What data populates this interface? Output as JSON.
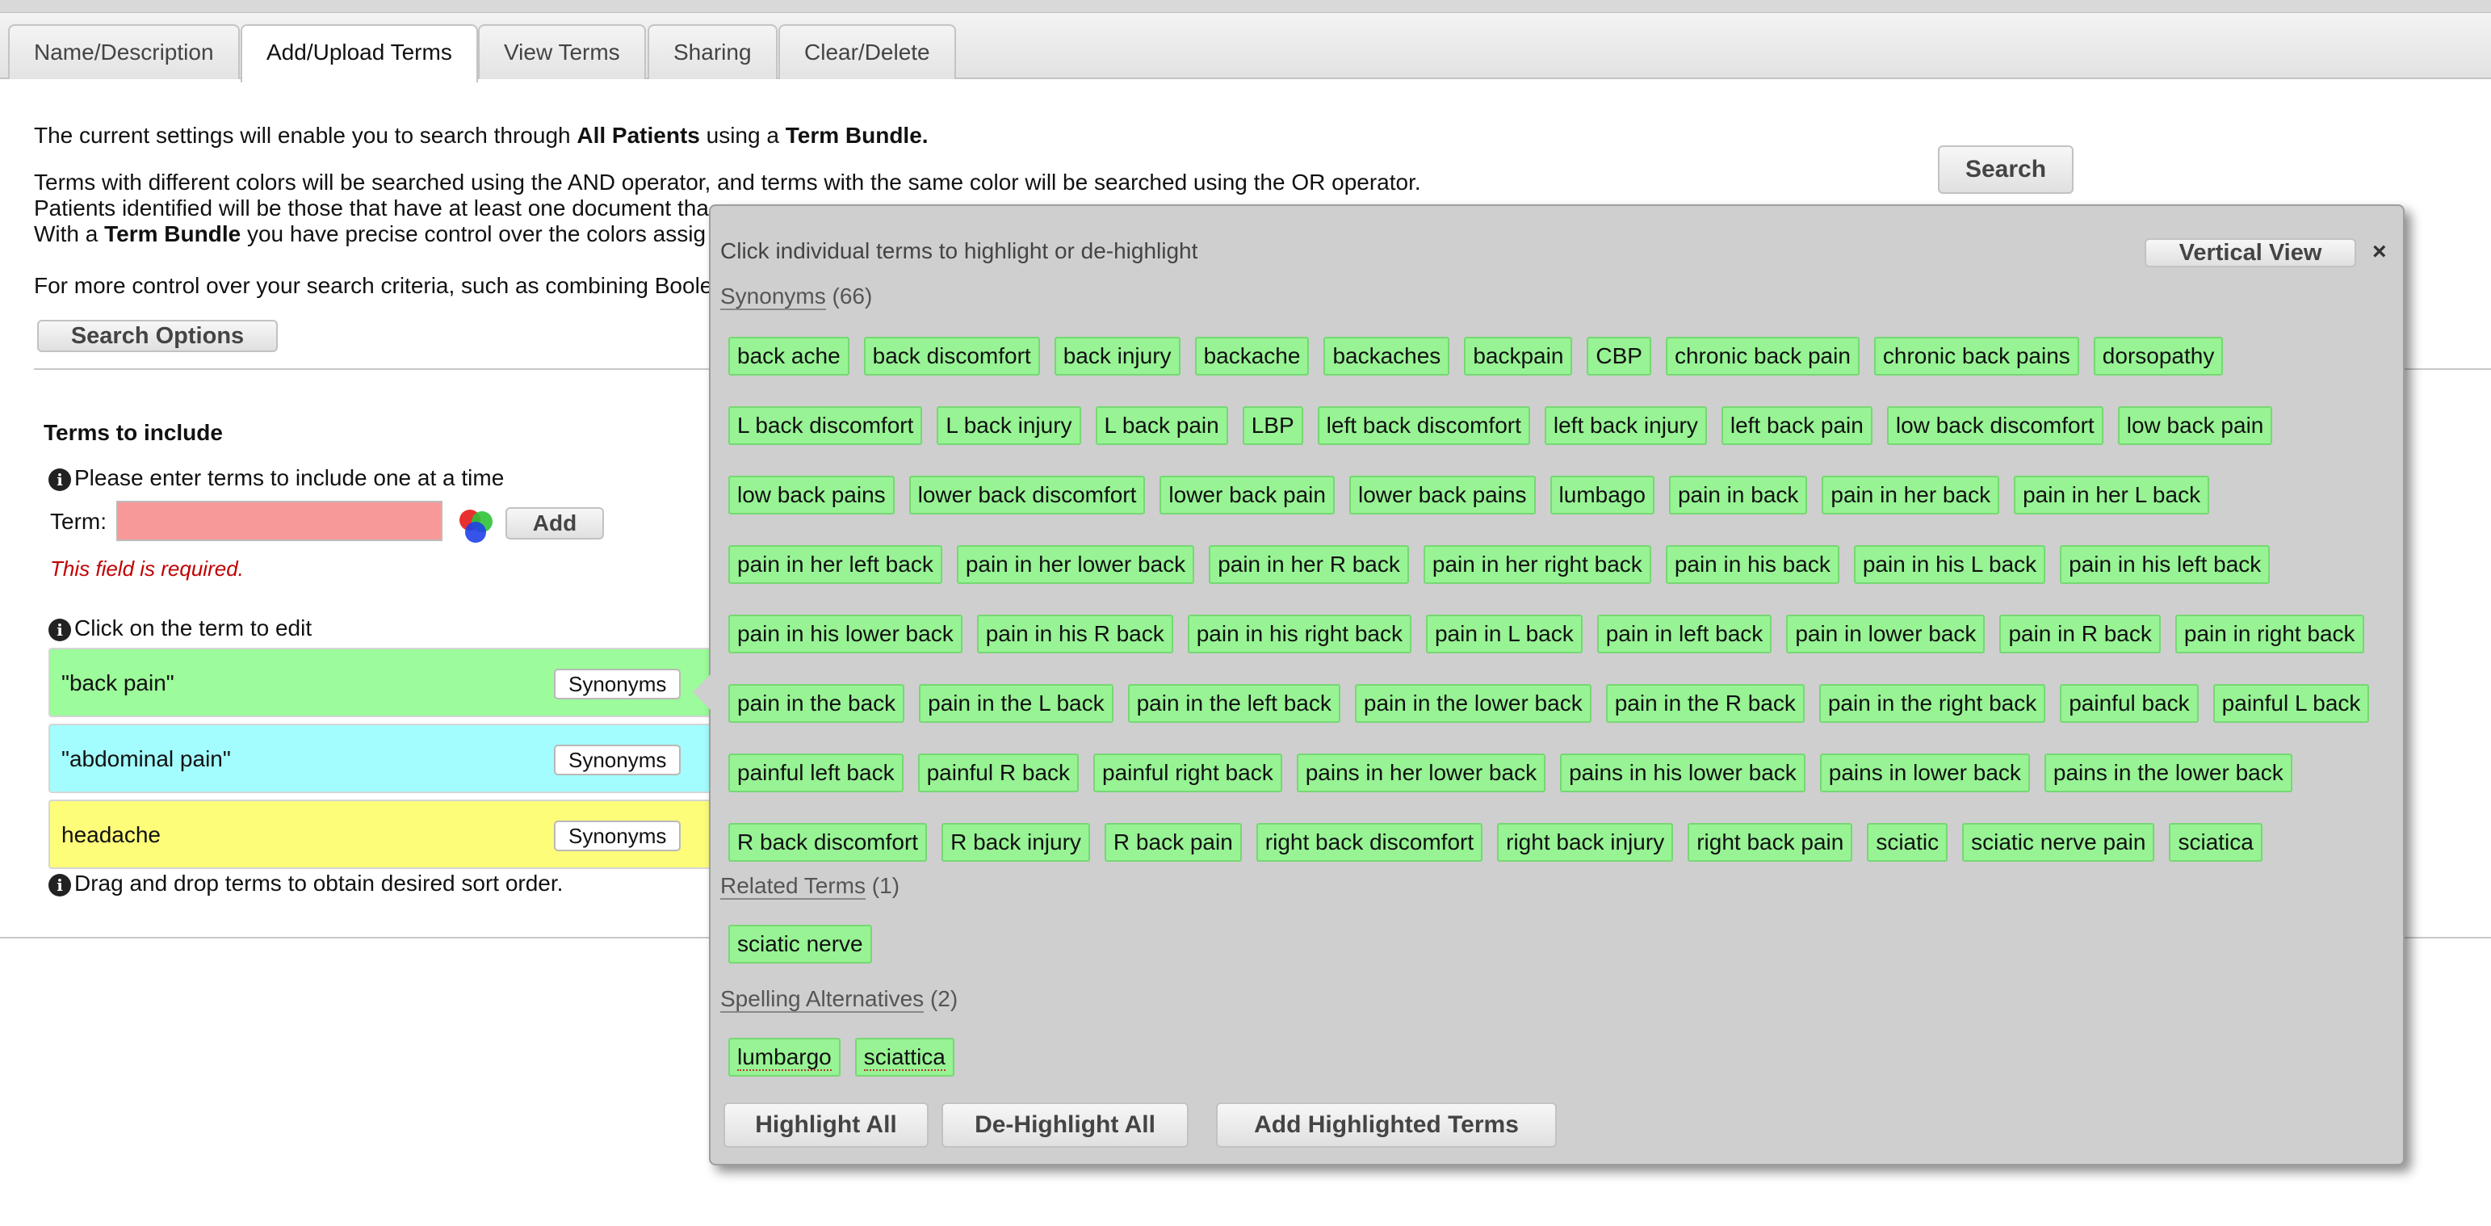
{
  "tabs": [
    {
      "label": "Name/Description",
      "active": false
    },
    {
      "label": "Add/Upload Terms",
      "active": true
    },
    {
      "label": "View Terms",
      "active": false
    },
    {
      "label": "Sharing",
      "active": false
    },
    {
      "label": "Clear/Delete",
      "active": false
    }
  ],
  "intro": {
    "line1_prefix": "The current settings will enable you to search through ",
    "line1_bold1": "All Patients",
    "line1_mid": " using a ",
    "line1_bold2": "Term Bundle.",
    "line2": "Terms with different colors will be searched using the AND operator, and terms with the same color will be searched using the OR operator.",
    "line3": "Patients identified will be those that have at least one document tha",
    "line4_prefix": "With a ",
    "line4_bold": "Term Bundle",
    "line4_suffix": " you have precise control over the colors assig",
    "line5": "For more control over your search criteria, such as combining Boole"
  },
  "search_button": "Search",
  "search_options_button": "Search Options",
  "terms_section": {
    "heading": "Terms to include",
    "instruction": "Please enter terms to include one at a time",
    "term_label": "Term:",
    "term_input_value": "",
    "add_button": "Add",
    "validation_error": "This field is required.",
    "edit_hint": "Click on the term to edit",
    "drag_hint": "Drag and drop terms to obtain desired sort order.",
    "terms": [
      {
        "text": "\"back pain\"",
        "color": "#9cfb9a",
        "button": "Synonyms"
      },
      {
        "text": "\"abdominal pain\"",
        "color": "#a3fcfd",
        "button": "Synonyms"
      },
      {
        "text": "headache",
        "color": "#fdfd7a",
        "button": "Synonyms"
      }
    ]
  },
  "popup": {
    "instruction": "Click individual terms to highlight or de-highlight",
    "vertical_view_button": "Vertical View",
    "close_label": "×",
    "synonyms": {
      "label": "Synonyms",
      "count": "(66)",
      "items": [
        "back ache",
        "back discomfort",
        "back injury",
        "backache",
        "backaches",
        "backpain",
        "CBP",
        "chronic back pain",
        "chronic back pains",
        "dorsopathy",
        "L back discomfort",
        "L back injury",
        "L back pain",
        "LBP",
        "left back discomfort",
        "left back injury",
        "left back pain",
        "low back discomfort",
        "low back pain",
        "low back pains",
        "lower back discomfort",
        "lower back pain",
        "lower back pains",
        "lumbago",
        "pain in back",
        "pain in her back",
        "pain in her L back",
        "pain in her left back",
        "pain in her lower back",
        "pain in her R back",
        "pain in her right back",
        "pain in his back",
        "pain in his L back",
        "pain in his left back",
        "pain in his lower back",
        "pain in his R back",
        "pain in his right back",
        "pain in L back",
        "pain in left back",
        "pain in lower back",
        "pain in R back",
        "pain in right back",
        "pain in the back",
        "pain in the L back",
        "pain in the left back",
        "pain in the lower back",
        "pain in the R back",
        "pain in the right back",
        "painful back",
        "painful L back",
        "painful left back",
        "painful R back",
        "painful right back",
        "pains in her lower back",
        "pains in his lower back",
        "pains in lower back",
        "pains in the lower back",
        "R back discomfort",
        "R back injury",
        "R back pain",
        "right back discomfort",
        "right back injury",
        "right back pain",
        "sciatic",
        "sciatic nerve pain",
        "sciatica"
      ]
    },
    "related": {
      "label": "Related Terms",
      "count": "(1)",
      "items": [
        "sciatic nerve"
      ]
    },
    "spelling": {
      "label": "Spelling Alternatives",
      "count": "(2)",
      "items": [
        "lumbargo",
        "sciattica"
      ]
    },
    "highlight_all_button": "Highlight All",
    "dehighlight_all_button": "De-Highlight All",
    "add_highlighted_button": "Add Highlighted Terms"
  }
}
